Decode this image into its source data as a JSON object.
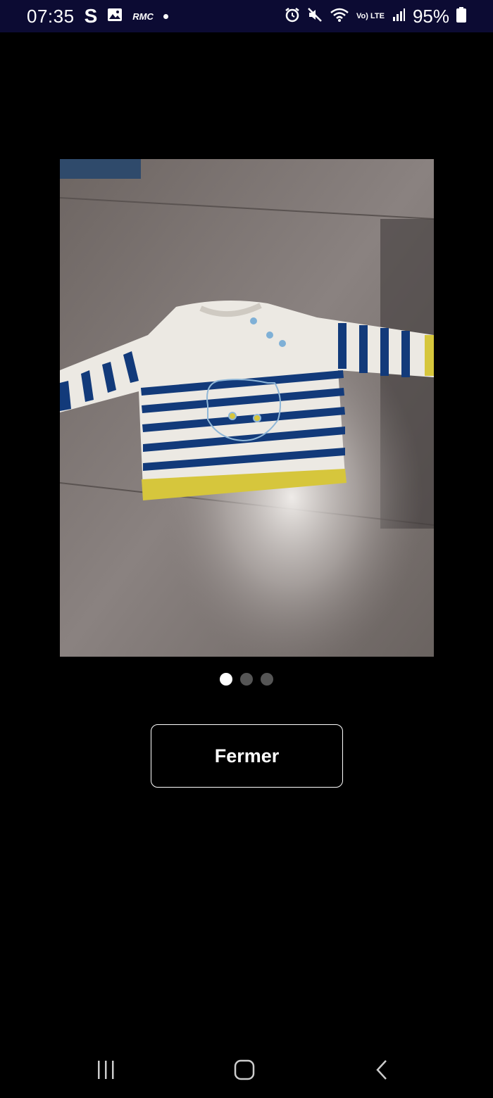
{
  "status_bar": {
    "time": "07:35",
    "carrier_icon_text": "S",
    "radio_icon_text": "RMC",
    "volte_text": "Vo) LTE",
    "battery_percent": "95%",
    "icons": [
      "gallery-icon",
      "notification-dot-icon",
      "alarm-icon",
      "mute-icon",
      "wifi-icon",
      "volte-icon",
      "signal-icon",
      "battery-icon"
    ]
  },
  "viewer": {
    "image_alt": "Pull rayé bébé",
    "pager": {
      "count": 3,
      "active_index": 0
    },
    "close_label": "Fermer"
  },
  "nav_bar": {
    "icons": [
      "recents-icon",
      "home-icon",
      "back-icon"
    ]
  },
  "colors": {
    "status_bar_bg": "#0c0b33",
    "background": "#000000",
    "sweater_stripe": "#123a7a",
    "sweater_trim": "#d6c63c"
  }
}
